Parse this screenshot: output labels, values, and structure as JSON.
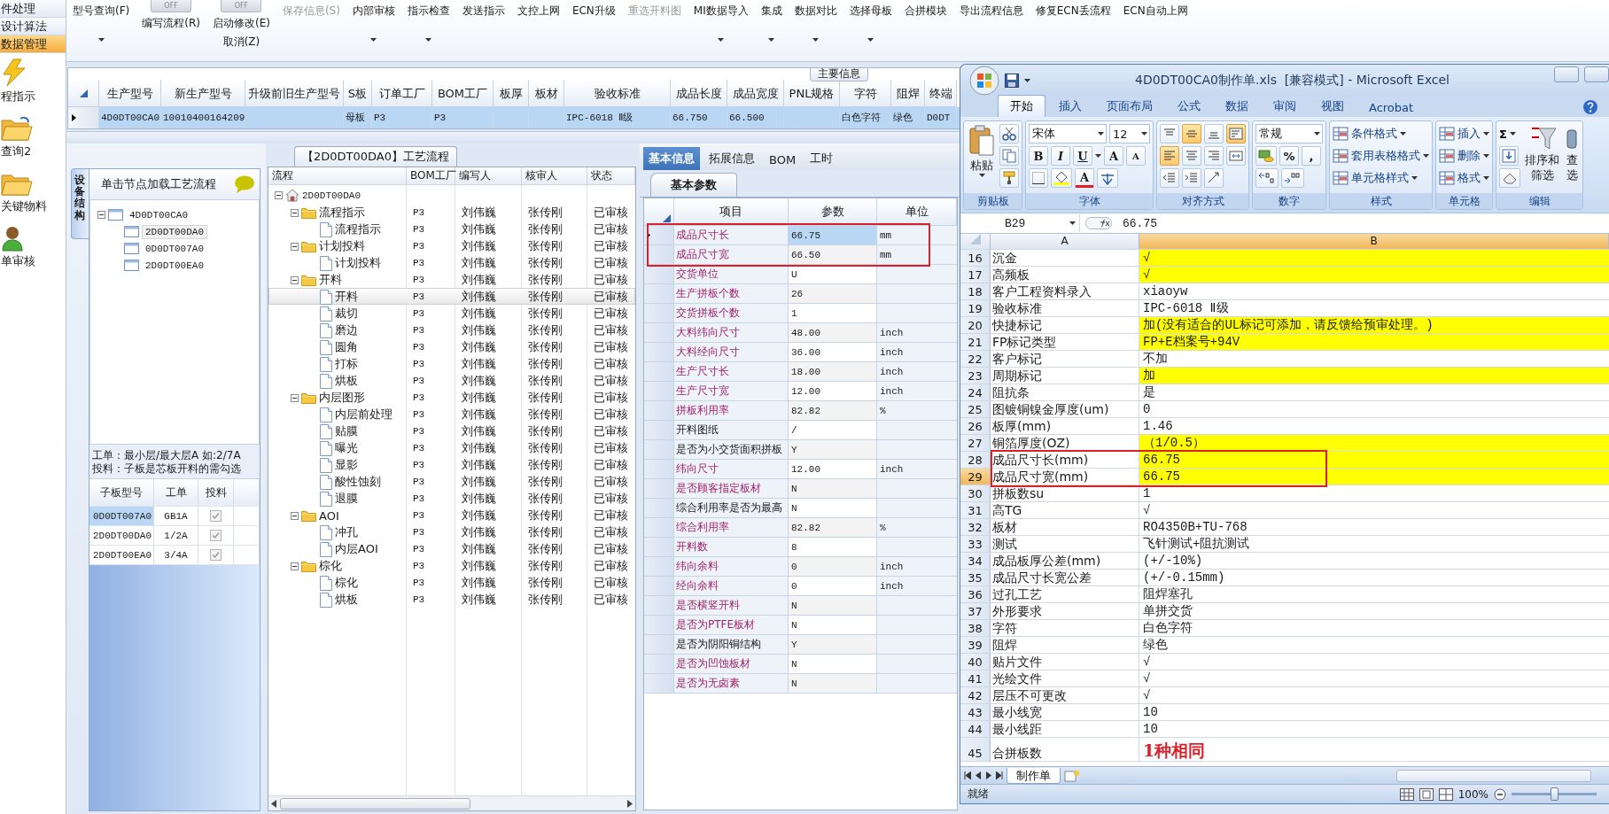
{
  "nav": [
    {
      "label": "件处理",
      "kind": "text",
      "selected": false
    },
    {
      "label": "设计算法",
      "kind": "text",
      "selected": false
    },
    {
      "label": "数据管理",
      "kind": "text",
      "selected": true
    },
    {
      "label": "程指示",
      "kind": "icon",
      "selected": false
    },
    {
      "label": "查询2",
      "kind": "icon",
      "selected": false
    },
    {
      "label": "关键物料",
      "kind": "icon",
      "selected": false
    },
    {
      "label": "单审核",
      "kind": "icon",
      "selected": false
    }
  ],
  "toolbar": [
    {
      "kind": "button",
      "label": "型号查询(F)",
      "menu": true,
      "disabled": false
    },
    {
      "kind": "switch",
      "switch": "OFF",
      "on": false,
      "label": "编写流程(R)",
      "menu": false,
      "disabled": false
    },
    {
      "kind": "switch",
      "switch": "OFF",
      "on": false,
      "label": "启动修改(E)",
      "label2": "取消(Z)",
      "menu": false,
      "disabled": false
    },
    {
      "kind": "button",
      "label": "保存信息(S)",
      "menu": false,
      "disabled": true
    },
    {
      "kind": "button",
      "label": "内部审核",
      "menu": true,
      "disabled": false
    },
    {
      "kind": "button",
      "label": "指示检查",
      "menu": true,
      "disabled": false
    },
    {
      "kind": "button",
      "label": "发送指示",
      "menu": false,
      "disabled": false
    },
    {
      "kind": "button",
      "label": "文控上网",
      "menu": false,
      "disabled": false
    },
    {
      "kind": "button",
      "label": "ECN升级",
      "menu": false,
      "disabled": false
    },
    {
      "kind": "button",
      "label": "重选开料图",
      "menu": false,
      "disabled": true
    },
    {
      "kind": "button",
      "label": "MI数据导入",
      "menu": true,
      "disabled": false
    },
    {
      "kind": "button",
      "label": "集成",
      "menu": true,
      "disabled": false
    },
    {
      "kind": "button",
      "label": "数据对比",
      "menu": true,
      "disabled": false
    },
    {
      "kind": "button",
      "label": "选择母板",
      "menu": true,
      "disabled": false
    },
    {
      "kind": "button",
      "label": "合拼模块",
      "menu": false,
      "disabled": false
    },
    {
      "kind": "button",
      "label": "导出流程信息",
      "menu": false,
      "disabled": false
    },
    {
      "kind": "button",
      "label": "修复ECN丢流程",
      "menu": false,
      "disabled": false
    },
    {
      "kind": "button",
      "label": "ECN自动上网",
      "menu": false,
      "disabled": false
    }
  ],
  "main_info": {
    "title": "主要信息",
    "columns": [
      "生产型号",
      "新生产型号",
      "升级前旧生产型号",
      "S板",
      "订单工厂",
      "BOM工厂",
      "板厚",
      "板材",
      "验收标准",
      "成品长度",
      "成品宽度",
      "PNL规格",
      "字符",
      "阻焊",
      "终端"
    ],
    "rows": [
      {
        "selected": true,
        "cells": [
          "4D0DT00CA0",
          "10010400164209",
          "",
          "母板",
          "P3",
          "P3",
          "",
          "",
          "IPC-6018 Ⅱ级",
          "66.750",
          "66.500",
          "",
          "白色字符",
          "绿色",
          "D0DT"
        ]
      }
    ]
  },
  "structure": {
    "tab": "设备结构",
    "header": "单击节点加载工艺流程",
    "tree": [
      {
        "label": "4D0DT00CA0",
        "selected": false,
        "expanded": true,
        "children": [
          {
            "label": "2D0DT00DA0",
            "selected": true
          },
          {
            "label": "0D0DT007A0",
            "selected": false
          },
          {
            "label": "2D0DT00EA0",
            "selected": false
          }
        ]
      }
    ],
    "notes": [
      "工单：最小层/最大层A 如:2/7A",
      "投料：子板是芯板开料的需勾选"
    ],
    "columns": [
      "子板型号",
      "工单",
      "投料"
    ],
    "rows": [
      {
        "board": "0D0DT007A0",
        "order": "GB1A",
        "checked": true,
        "selected": true
      },
      {
        "board": "2D0DT00DA0",
        "order": "1/2A",
        "checked": true,
        "selected": false
      },
      {
        "board": "2D0DT00EA0",
        "order": "3/4A",
        "checked": true,
        "selected": false
      }
    ]
  },
  "process": {
    "title": "【2D0DT00DA0】工艺流程",
    "columns": [
      "流程",
      "BOM工厂",
      "编写人",
      "核审人",
      "状态"
    ],
    "tree": [
      {
        "kind": "root",
        "label": "2D0DT00DA0",
        "selected": false,
        "expanded": true,
        "children": [
          {
            "kind": "folder",
            "label": "流程指示",
            "cells": [
              "P3",
              "刘伟巍",
              "张传刚",
              "已审核"
            ],
            "selected": false,
            "expanded": true,
            "children": [
              {
                "kind": "step",
                "label": "流程指示",
                "cells": [
                  "P3",
                  "刘伟巍",
                  "张传刚",
                  "已审核"
                ],
                "selected": false
              }
            ]
          },
          {
            "kind": "folder",
            "label": "计划投料",
            "cells": [
              "P3",
              "刘伟巍",
              "张传刚",
              "已审核"
            ],
            "selected": false,
            "expanded": true,
            "children": [
              {
                "kind": "step",
                "label": "计划投料",
                "cells": [
                  "P3",
                  "刘伟巍",
                  "张传刚",
                  "已审核"
                ],
                "selected": false
              }
            ]
          },
          {
            "kind": "folder",
            "label": "开料",
            "cells": [
              "P3",
              "刘伟巍",
              "张传刚",
              "已审核"
            ],
            "selected": false,
            "expanded": true,
            "children": [
              {
                "kind": "step",
                "label": "开料",
                "cells": [
                  "P3",
                  "刘伟巍",
                  "张传刚",
                  "已审核"
                ],
                "selected": true
              },
              {
                "kind": "step",
                "label": "裁切",
                "cells": [
                  "P3",
                  "刘伟巍",
                  "张传刚",
                  "已审核"
                ],
                "selected": false
              },
              {
                "kind": "step",
                "label": "磨边",
                "cells": [
                  "P3",
                  "刘伟巍",
                  "张传刚",
                  "已审核"
                ],
                "selected": false
              },
              {
                "kind": "step",
                "label": "圆角",
                "cells": [
                  "P3",
                  "刘伟巍",
                  "张传刚",
                  "已审核"
                ],
                "selected": false
              },
              {
                "kind": "step",
                "label": "打标",
                "cells": [
                  "P3",
                  "刘伟巍",
                  "张传刚",
                  "已审核"
                ],
                "selected": false
              },
              {
                "kind": "step",
                "label": "烘板",
                "cells": [
                  "P3",
                  "刘伟巍",
                  "张传刚",
                  "已审核"
                ],
                "selected": false
              }
            ]
          },
          {
            "kind": "folder",
            "label": "内层图形",
            "cells": [
              "P3",
              "刘伟巍",
              "张传刚",
              "已审核"
            ],
            "selected": false,
            "expanded": true,
            "children": [
              {
                "kind": "step",
                "label": "内层前处理",
                "cells": [
                  "P3",
                  "刘伟巍",
                  "张传刚",
                  "已审核"
                ],
                "selected": false
              },
              {
                "kind": "step",
                "label": "贴膜",
                "cells": [
                  "P3",
                  "刘伟巍",
                  "张传刚",
                  "已审核"
                ],
                "selected": false
              },
              {
                "kind": "step",
                "label": "曝光",
                "cells": [
                  "P3",
                  "刘伟巍",
                  "张传刚",
                  "已审核"
                ],
                "selected": false
              },
              {
                "kind": "step",
                "label": "显影",
                "cells": [
                  "P3",
                  "刘伟巍",
                  "张传刚",
                  "已审核"
                ],
                "selected": false
              },
              {
                "kind": "step",
                "label": "酸性蚀刻",
                "cells": [
                  "P3",
                  "刘伟巍",
                  "张传刚",
                  "已审核"
                ],
                "selected": false
              },
              {
                "kind": "step",
                "label": "退膜",
                "cells": [
                  "P3",
                  "刘伟巍",
                  "张传刚",
                  "已审核"
                ],
                "selected": false
              }
            ]
          },
          {
            "kind": "folder",
            "label": "AOI",
            "cells": [
              "P3",
              "刘伟巍",
              "张传刚",
              "已审核"
            ],
            "selected": false,
            "expanded": true,
            "children": [
              {
                "kind": "step",
                "label": "冲孔",
                "cells": [
                  "P3",
                  "刘伟巍",
                  "张传刚",
                  "已审核"
                ],
                "selected": false
              },
              {
                "kind": "step",
                "label": "内层AOI",
                "cells": [
                  "P3",
                  "刘伟巍",
                  "张传刚",
                  "已审核"
                ],
                "selected": false
              }
            ]
          },
          {
            "kind": "folder",
            "label": "棕化",
            "cells": [
              "P3",
              "刘伟巍",
              "张传刚",
              "已审核"
            ],
            "selected": false,
            "expanded": true,
            "children": [
              {
                "kind": "step",
                "label": "棕化",
                "cells": [
                  "P3",
                  "刘伟巍",
                  "张传刚",
                  "已审核"
                ],
                "selected": false
              },
              {
                "kind": "step",
                "label": "烘板",
                "cells": [
                  "P3",
                  "刘伟巍",
                  "张传刚",
                  "已审核"
                ],
                "selected": false
              }
            ]
          }
        ]
      }
    ]
  },
  "params": {
    "tabs": [
      {
        "label": "基本信息",
        "selected": true
      },
      {
        "label": "拓展信息",
        "selected": false
      },
      {
        "label": "BOM",
        "selected": false
      },
      {
        "label": "工时",
        "selected": false
      }
    ],
    "subtab": "基本参数",
    "columns": [
      "项目",
      "参数",
      "单位"
    ],
    "rows": [
      {
        "item": "成品尺寸长",
        "value": "66.75",
        "unit": "mm",
        "flagged": true,
        "selected": true,
        "annotated": true
      },
      {
        "item": "成品尺寸宽",
        "value": "66.50",
        "unit": "mm",
        "flagged": true,
        "selected": false,
        "annotated": true
      },
      {
        "item": "交货单位",
        "value": "U",
        "unit": "",
        "flagged": true,
        "selected": false,
        "annotated": false
      },
      {
        "item": "生产拼板个数",
        "value": "26",
        "unit": "",
        "flagged": true,
        "selected": false,
        "annotated": false
      },
      {
        "item": "交货拼板个数",
        "value": "1",
        "unit": "",
        "flagged": true,
        "selected": false,
        "annotated": false
      },
      {
        "item": "大料纬向尺寸",
        "value": "48.00",
        "unit": "inch",
        "flagged": true,
        "selected": false,
        "annotated": false
      },
      {
        "item": "大料经向尺寸",
        "value": "36.00",
        "unit": "inch",
        "flagged": true,
        "selected": false,
        "annotated": false
      },
      {
        "item": "生产尺寸长",
        "value": "18.00",
        "unit": "inch",
        "flagged": true,
        "selected": false,
        "annotated": false
      },
      {
        "item": "生产尺寸宽",
        "value": "12.00",
        "unit": "inch",
        "flagged": true,
        "selected": false,
        "annotated": false
      },
      {
        "item": "拼板利用率",
        "value": "82.82",
        "unit": "%",
        "flagged": true,
        "selected": false,
        "annotated": false
      },
      {
        "item": "开料图纸",
        "value": "/",
        "unit": "",
        "flagged": false,
        "selected": false,
        "annotated": false
      },
      {
        "item": "是否为小交货面积拼板",
        "value": "Y",
        "unit": "",
        "flagged": false,
        "selected": false,
        "annotated": false
      },
      {
        "item": "纬向尺寸",
        "value": "12.00",
        "unit": "inch",
        "flagged": true,
        "selected": false,
        "annotated": false
      },
      {
        "item": "是否顾客指定板材",
        "value": "N",
        "unit": "",
        "flagged": true,
        "selected": false,
        "annotated": false
      },
      {
        "item": "综合利用率是否为最高",
        "value": "N",
        "unit": "",
        "flagged": false,
        "selected": false,
        "annotated": false
      },
      {
        "item": "综合利用率",
        "value": "82.82",
        "unit": "%",
        "flagged": true,
        "selected": false,
        "annotated": false
      },
      {
        "item": "开料数",
        "value": "8",
        "unit": "",
        "flagged": true,
        "selected": false,
        "annotated": false
      },
      {
        "item": "纬向余料",
        "value": "0",
        "unit": "inch",
        "flagged": true,
        "selected": false,
        "annotated": false
      },
      {
        "item": "经向余料",
        "value": "0",
        "unit": "inch",
        "flagged": true,
        "selected": false,
        "annotated": false
      },
      {
        "item": "是否横竖开料",
        "value": "N",
        "unit": "",
        "flagged": true,
        "selected": false,
        "annotated": false
      },
      {
        "item": "是否为PTFE板材",
        "value": "N",
        "unit": "",
        "flagged": true,
        "selected": false,
        "annotated": false
      },
      {
        "item": "是否为阴阳铜结构",
        "value": "Y",
        "unit": "",
        "flagged": false,
        "selected": false,
        "annotated": false
      },
      {
        "item": "是否为凹蚀板材",
        "value": "N",
        "unit": "",
        "flagged": true,
        "selected": false,
        "annotated": false
      },
      {
        "item": "是否为无卤素",
        "value": "N",
        "unit": "",
        "flagged": true,
        "selected": false,
        "annotated": false
      }
    ]
  },
  "excel": {
    "title": "4D0DT00CA0制作单.xls  [兼容模式] - Microsoft Excel",
    "tabs": [
      {
        "label": "开始",
        "selected": true
      },
      {
        "label": "插入",
        "selected": false
      },
      {
        "label": "页面布局",
        "selected": false
      },
      {
        "label": "公式",
        "selected": false
      },
      {
        "label": "数据",
        "selected": false
      },
      {
        "label": "审阅",
        "selected": false
      },
      {
        "label": "视图",
        "selected": false
      },
      {
        "label": "Acrobat",
        "selected": false
      }
    ],
    "groups": [
      {
        "kind": "clipboard",
        "label": "剪贴板",
        "paste": "粘贴"
      },
      {
        "kind": "font",
        "label": "字体",
        "font": "宋体",
        "size": "12",
        "bold": "B",
        "italic": "I",
        "underline": "U",
        "grow": "A",
        "shrink": "A",
        "font_color": "A"
      },
      {
        "kind": "align",
        "label": "对齐方式",
        "buttons": [
          {
            "kind": "top",
            "on": false
          },
          {
            "kind": "middle",
            "on": true
          },
          {
            "kind": "bottom",
            "on": false
          },
          {
            "kind": "wrap",
            "on": true
          },
          {
            "kind": "left",
            "on": true
          },
          {
            "kind": "center",
            "on": false
          },
          {
            "kind": "right",
            "on": false
          },
          {
            "kind": "merge",
            "on": false
          },
          {
            "kind": "outdent",
            "on": false
          },
          {
            "kind": "indent",
            "on": false
          },
          {
            "kind": "orient",
            "on": false
          }
        ]
      },
      {
        "kind": "number",
        "label": "数字",
        "format": "常规",
        "percent": "%",
        "comma": ","
      },
      {
        "kind": "list",
        "label": "样式",
        "items": [
          "条件格式",
          "套用表格格式",
          "单元格样式"
        ]
      },
      {
        "kind": "list",
        "label": "单元格",
        "items": [
          "插入",
          "删除",
          "格式"
        ]
      },
      {
        "kind": "editing",
        "label": "编辑",
        "sum": "Σ",
        "sort": [
          "排序和",
          "筛选"
        ],
        "find": [
          "查",
          "选"
        ]
      }
    ],
    "name_box": "B29",
    "formula": "66.75",
    "columns": [
      {
        "label": "A",
        "selected": false
      },
      {
        "label": "B",
        "selected": true
      }
    ],
    "rows": [
      {
        "num": "16",
        "a": "沉金",
        "b": "√",
        "color": "#ffff00",
        "selected": false,
        "annotated": false,
        "alert": false
      },
      {
        "num": "17",
        "a": "高频板",
        "b": "√",
        "color": "#ffff00",
        "selected": false,
        "annotated": false,
        "alert": false
      },
      {
        "num": "18",
        "a": "客户工程资料录入",
        "b": "xiaoyw",
        "color": "#ffffff",
        "selected": false,
        "annotated": false,
        "alert": false
      },
      {
        "num": "19",
        "a": "验收标准",
        "b": "IPC-6018 Ⅱ级",
        "color": "#ffffff",
        "selected": false,
        "annotated": false,
        "alert": false
      },
      {
        "num": "20",
        "a": "快捷标记",
        "b": "加(没有适合的UL标记可添加，请反馈给预审处理。)",
        "color": "#ffff00",
        "selected": false,
        "annotated": false,
        "alert": false
      },
      {
        "num": "21",
        "a": "FP标记类型",
        "b": "FP+E档案号+94V",
        "color": "#ffff00",
        "selected": false,
        "annotated": false,
        "alert": false
      },
      {
        "num": "22",
        "a": "客户标记",
        "b": "不加",
        "color": "#ffffff",
        "selected": false,
        "annotated": false,
        "alert": false
      },
      {
        "num": "23",
        "a": "周期标记",
        "b": "加",
        "color": "#ffff00",
        "selected": false,
        "annotated": false,
        "alert": false
      },
      {
        "num": "24",
        "a": "阻抗条",
        "b": "是",
        "color": "#ffffff",
        "selected": false,
        "annotated": false,
        "alert": false
      },
      {
        "num": "25",
        "a": "图镀铜镍金厚度(um)",
        "b": "0",
        "color": "#ffffff",
        "selected": false,
        "annotated": false,
        "alert": false
      },
      {
        "num": "26",
        "a": "板厚(mm)",
        "b": "1.46",
        "color": "#ffffff",
        "selected": false,
        "annotated": false,
        "alert": false
      },
      {
        "num": "27",
        "a": "铜箔厚度(OZ)",
        "b": "（1/0.5）",
        "color": "#ffff00",
        "selected": false,
        "annotated": false,
        "alert": false
      },
      {
        "num": "28",
        "a": "成品尺寸长(mm)",
        "b": "66.75",
        "color": "#ffff00",
        "selected": false,
        "annotated": true,
        "alert": false
      },
      {
        "num": "29",
        "a": "成品尺寸宽(mm)",
        "b": "66.75",
        "color": "#ffff00",
        "selected": true,
        "annotated": true,
        "alert": false
      },
      {
        "num": "30",
        "a": "拼板数su",
        "b": "1",
        "color": "#ffffff",
        "selected": false,
        "annotated": false,
        "alert": false
      },
      {
        "num": "31",
        "a": "高TG",
        "b": "√",
        "color": "#ffffff",
        "selected": false,
        "annotated": false,
        "alert": false
      },
      {
        "num": "32",
        "a": "板材",
        "b": "RO4350B+TU-768",
        "color": "#ffffff",
        "selected": false,
        "annotated": false,
        "alert": false
      },
      {
        "num": "33",
        "a": "测试",
        "b": "飞针测试+阻抗测试",
        "color": "#ffffff",
        "selected": false,
        "annotated": false,
        "alert": false
      },
      {
        "num": "34",
        "a": "成品板厚公差(mm)",
        "b": "(+/-10%)",
        "color": "#ffffff",
        "selected": false,
        "annotated": false,
        "alert": false
      },
      {
        "num": "35",
        "a": "成品尺寸长宽公差",
        "b": "(+/-0.15mm)",
        "color": "#ffffff",
        "selected": false,
        "annotated": false,
        "alert": false
      },
      {
        "num": "36",
        "a": "过孔工艺",
        "b": "阻焊塞孔",
        "color": "#ffffff",
        "selected": false,
        "annotated": false,
        "alert": false
      },
      {
        "num": "37",
        "a": "外形要求",
        "b": "单拼交货",
        "color": "#ffffff",
        "selected": false,
        "annotated": false,
        "alert": false
      },
      {
        "num": "38",
        "a": "字符",
        "b": "白色字符",
        "color": "#ffffff",
        "selected": false,
        "annotated": false,
        "alert": false
      },
      {
        "num": "39",
        "a": "阻焊",
        "b": "绿色",
        "color": "#ffffff",
        "selected": false,
        "annotated": false,
        "alert": false
      },
      {
        "num": "40",
        "a": "贴片文件",
        "b": "√",
        "color": "#ffffff",
        "selected": false,
        "annotated": false,
        "alert": false
      },
      {
        "num": "41",
        "a": "光绘文件",
        "b": "√",
        "color": "#ffffff",
        "selected": false,
        "annotated": false,
        "alert": false
      },
      {
        "num": "42",
        "a": "层压不可更改",
        "b": "√",
        "color": "#ffffff",
        "selected": false,
        "annotated": false,
        "alert": false
      },
      {
        "num": "43",
        "a": "最小线宽",
        "b": "10",
        "color": "#ffffff",
        "selected": false,
        "annotated": false,
        "alert": false
      },
      {
        "num": "44",
        "a": "最小线距",
        "b": "10",
        "color": "#ffffff",
        "selected": false,
        "annotated": false,
        "alert": false
      },
      {
        "num": "45",
        "a": "合拼板数",
        "b": "1种相同",
        "color": "#ffffff",
        "selected": false,
        "annotated": false,
        "alert": true
      }
    ],
    "sheets": [
      {
        "label": "制作单",
        "selected": true
      }
    ],
    "status": "就绪",
    "zoom": "100%",
    "zoom_slider": {
      "level": 0.5
    }
  }
}
